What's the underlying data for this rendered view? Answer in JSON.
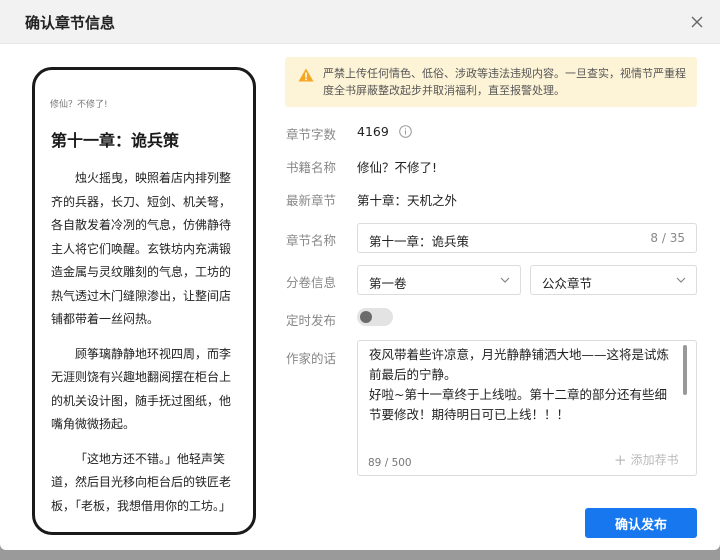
{
  "dialog": {
    "title": "确认章节信息"
  },
  "preview": {
    "book_name": "修仙？不修了!",
    "chapter_title": "第十一章：诡兵策",
    "paragraphs": [
      "烛火摇曳，映照着店内排列整齐的兵器，长刀、短剑、机关弩，各自散发着冷冽的气息，仿佛静待主人将它们唤醒。玄铁坊内充满锻造金属与灵纹雕刻的气息，工坊的热气透过木门缝隙渗出，让整间店铺都带着一丝闷热。",
      "顾筝璃静静地环视四周，而李无涯则饶有兴趣地翻阅摆在柜台上的机关设计图，随手抚过图纸，他嘴角微微扬起。",
      "「这地方还不错。」他轻声笑道，然后目光移向柜台后的铁匠老板，「老板，我想借用你的工坊。」"
    ]
  },
  "notice": {
    "text": "严禁上传任何情色、低俗、涉政等违法违规内容。一旦查实，视情节严重程度全书屏蔽整改起步并取消福利，直至报警处理。"
  },
  "form": {
    "word_count_label": "章节字数",
    "word_count": "4169",
    "book_label": "书籍名称",
    "book_name": "修仙？不修了!",
    "latest_label": "最新章节",
    "latest_chapter": "第十章：天机之外",
    "chapter_name_label": "章节名称",
    "chapter_name": "第十一章：诡兵策",
    "chapter_name_count": "8 / 35",
    "volume_label": "分卷信息",
    "volume": "第一卷",
    "chapter_type": "公众章节",
    "schedule_label": "定时发布",
    "schedule_enabled": false,
    "author_note_label": "作家的话",
    "author_note": "夜风带着些许凉意，月光静静铺洒大地——这将是试炼前最后的宁静。\n好啦~第十一章终于上线啦。第十二章的部分还有些细节要修改！期待明日可已上线！！！",
    "author_note_count": "89 / 500",
    "add_book_rec": "添加荐书"
  },
  "actions": {
    "confirm": "确认发布"
  },
  "colors": {
    "primary": "#1677ee",
    "notice_bg": "#fdf4d7",
    "warning": "#f5a623"
  },
  "icons": {
    "close": "close-icon",
    "warning": "warning-icon",
    "info": "info-icon",
    "chevron": "chevron-down-icon",
    "plus": "plus-icon"
  }
}
